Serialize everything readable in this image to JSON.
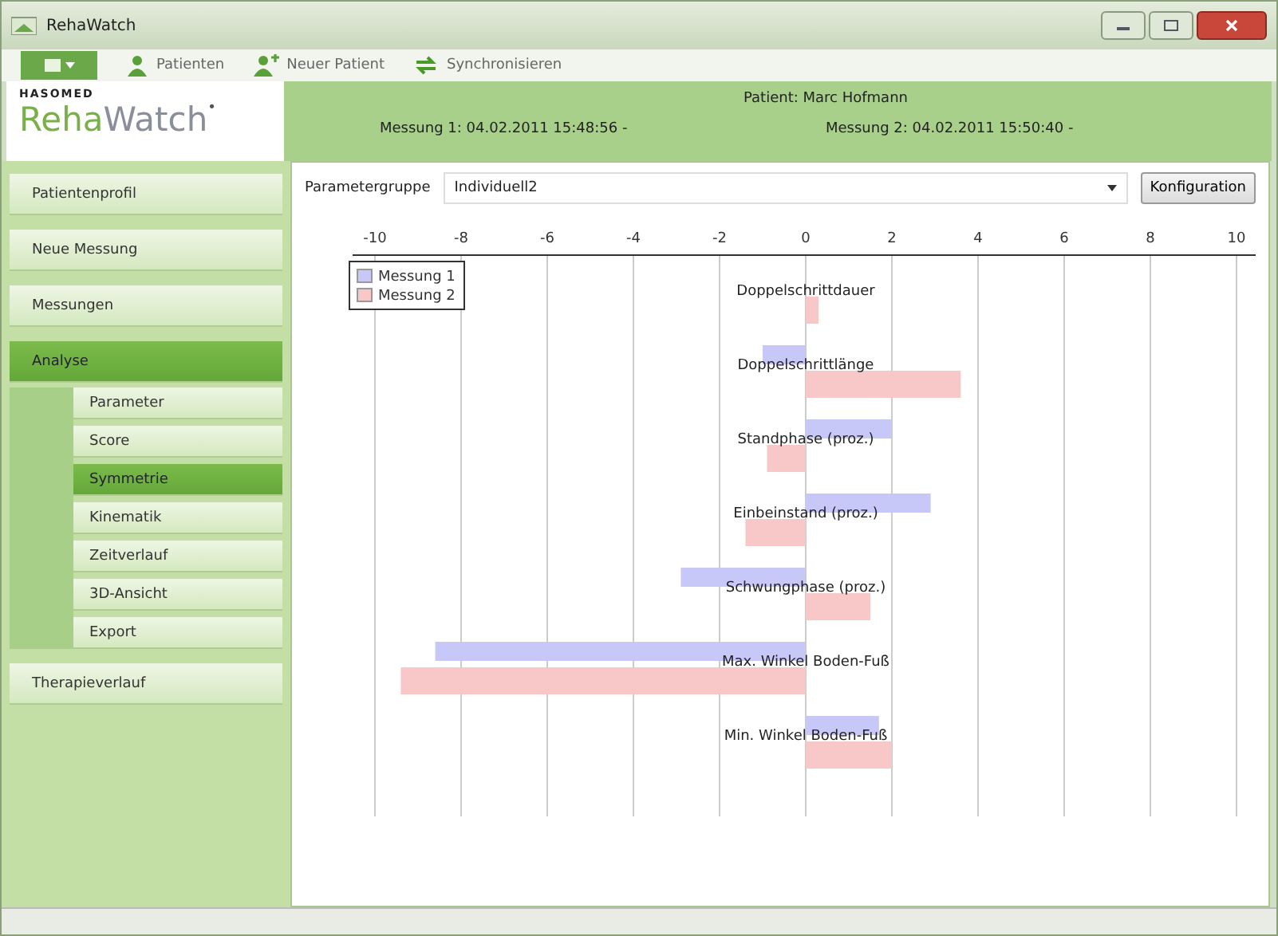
{
  "window": {
    "title": "RehaWatch"
  },
  "toolbar": [
    {
      "label": "Patienten"
    },
    {
      "label": "Neuer Patient"
    },
    {
      "label": "Synchronisieren"
    }
  ],
  "logo": {
    "maker": "HASOMED",
    "name_part_1": "Reha",
    "name_part_2": "Watch",
    "mark": "•"
  },
  "header": {
    "patient": "Patient: Marc Hofmann",
    "measurement_1": "Messung 1: 04.02.2011 15:48:56 -",
    "measurement_2": "Messung 2: 04.02.2011 15:50:40 -"
  },
  "sidebar": {
    "items": [
      {
        "label": "Patientenprofil",
        "selected": false
      },
      {
        "label": "Neue Messung",
        "selected": false
      },
      {
        "label": "Messungen",
        "selected": false
      },
      {
        "label": "Analyse",
        "selected": true,
        "expanded": true,
        "children": [
          {
            "label": "Parameter",
            "selected": false
          },
          {
            "label": "Score",
            "selected": false
          },
          {
            "label": "Symmetrie",
            "selected": true
          },
          {
            "label": "Kinematik",
            "selected": false
          },
          {
            "label": "Zeitverlauf",
            "selected": false
          },
          {
            "label": "3D-Ansicht",
            "selected": false
          },
          {
            "label": "Export",
            "selected": false
          }
        ]
      },
      {
        "label": "Therapieverlauf",
        "selected": false
      }
    ]
  },
  "parameter_group": {
    "label": "Parametergruppe",
    "value": "Individuell2",
    "button": "Konfiguration"
  },
  "chart_data": {
    "type": "bar",
    "orientation": "horizontal",
    "categories": [
      "Doppelschrittdauer",
      "Doppelschrittlänge",
      "Standphase (proz.)",
      "Einbeinstand (proz.)",
      "Schwungphase (proz.)",
      "Max. Winkel Boden-Fuß",
      "Min. Winkel Boden-Fuß"
    ],
    "series": [
      {
        "name": "Messung 1",
        "color": "#c8c8f8",
        "values": [
          0,
          -1.0,
          2.0,
          2.9,
          -2.9,
          -8.6,
          1.7
        ]
      },
      {
        "name": "Messung 2",
        "color": "#f8c8c8",
        "values": [
          0.3,
          3.6,
          -0.9,
          -1.4,
          1.5,
          -9.4,
          2.0
        ]
      }
    ],
    "grid": true,
    "legend": true,
    "xlim": [
      -10,
      10
    ],
    "xticks": [
      -10,
      -8,
      -6,
      -4,
      -2,
      0,
      2,
      4,
      6,
      8,
      10
    ]
  }
}
